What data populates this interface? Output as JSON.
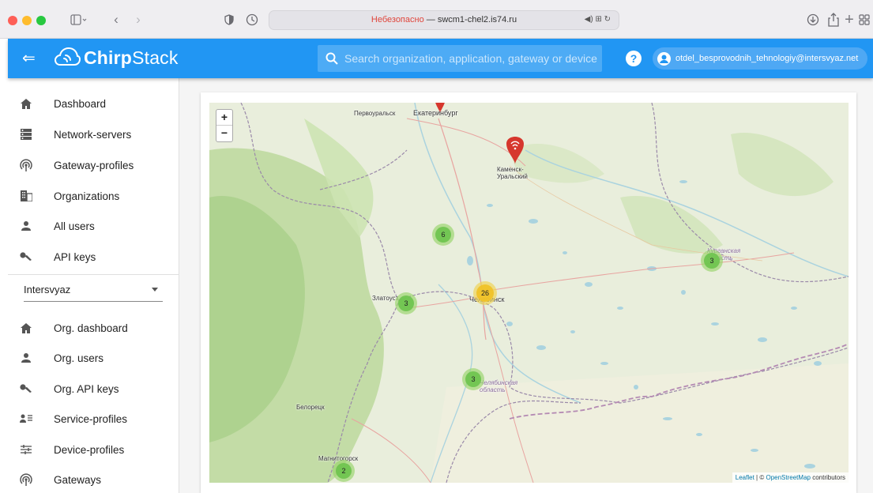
{
  "browser": {
    "address_warning": "Небезопасно",
    "address_sep": "—",
    "address_host": "swcm1-chel2.is74.ru"
  },
  "header": {
    "logo_text_bold": "Chirp",
    "logo_text": "Stack",
    "search_placeholder": "Search organization, application, gateway or device",
    "help_label": "?",
    "user_email": "otdel_besprovodnih_tehnologiy@intersvyaz.net"
  },
  "sidebar": {
    "items": [
      {
        "label": "Dashboard",
        "icon": "home-icon"
      },
      {
        "label": "Network-servers",
        "icon": "server-icon"
      },
      {
        "label": "Gateway-profiles",
        "icon": "wifi-tethering-icon"
      },
      {
        "label": "Organizations",
        "icon": "domain-icon"
      },
      {
        "label": "All users",
        "icon": "person-icon"
      },
      {
        "label": "API keys",
        "icon": "key-icon"
      }
    ],
    "organization": "Intersvyaz",
    "org_items": [
      {
        "label": "Org. dashboard",
        "icon": "home-icon"
      },
      {
        "label": "Org. users",
        "icon": "person-icon"
      },
      {
        "label": "Org. API keys",
        "icon": "key-icon"
      },
      {
        "label": "Service-profiles",
        "icon": "account-details-icon"
      },
      {
        "label": "Device-profiles",
        "icon": "tune-icon"
      },
      {
        "label": "Gateways",
        "icon": "wifi-tethering-icon"
      }
    ]
  },
  "map": {
    "zoom_in": "+",
    "zoom_out": "−",
    "cities": {
      "pervouralsk": "Первоуральск",
      "ekaterinburg": "Екатеринбург",
      "kamensk": "Каменск-\nУральский",
      "zlatoust": "Златоуст",
      "chelyabinsk": "Челябинск",
      "kurganskaya": "Курганская\nобласть",
      "chelyabinskaya": "Челябинская\nобласть",
      "beloretsk": "Белорецк",
      "magnitogorsk": "Магнитогорск"
    },
    "clusters": [
      "6",
      "3",
      "26",
      "3",
      "3",
      "2"
    ],
    "attribution_leaflet": "Leaflet",
    "attribution_sep": "| ©",
    "attribution_osm": "OpenStreetMap",
    "attribution_rest": "contributors"
  }
}
